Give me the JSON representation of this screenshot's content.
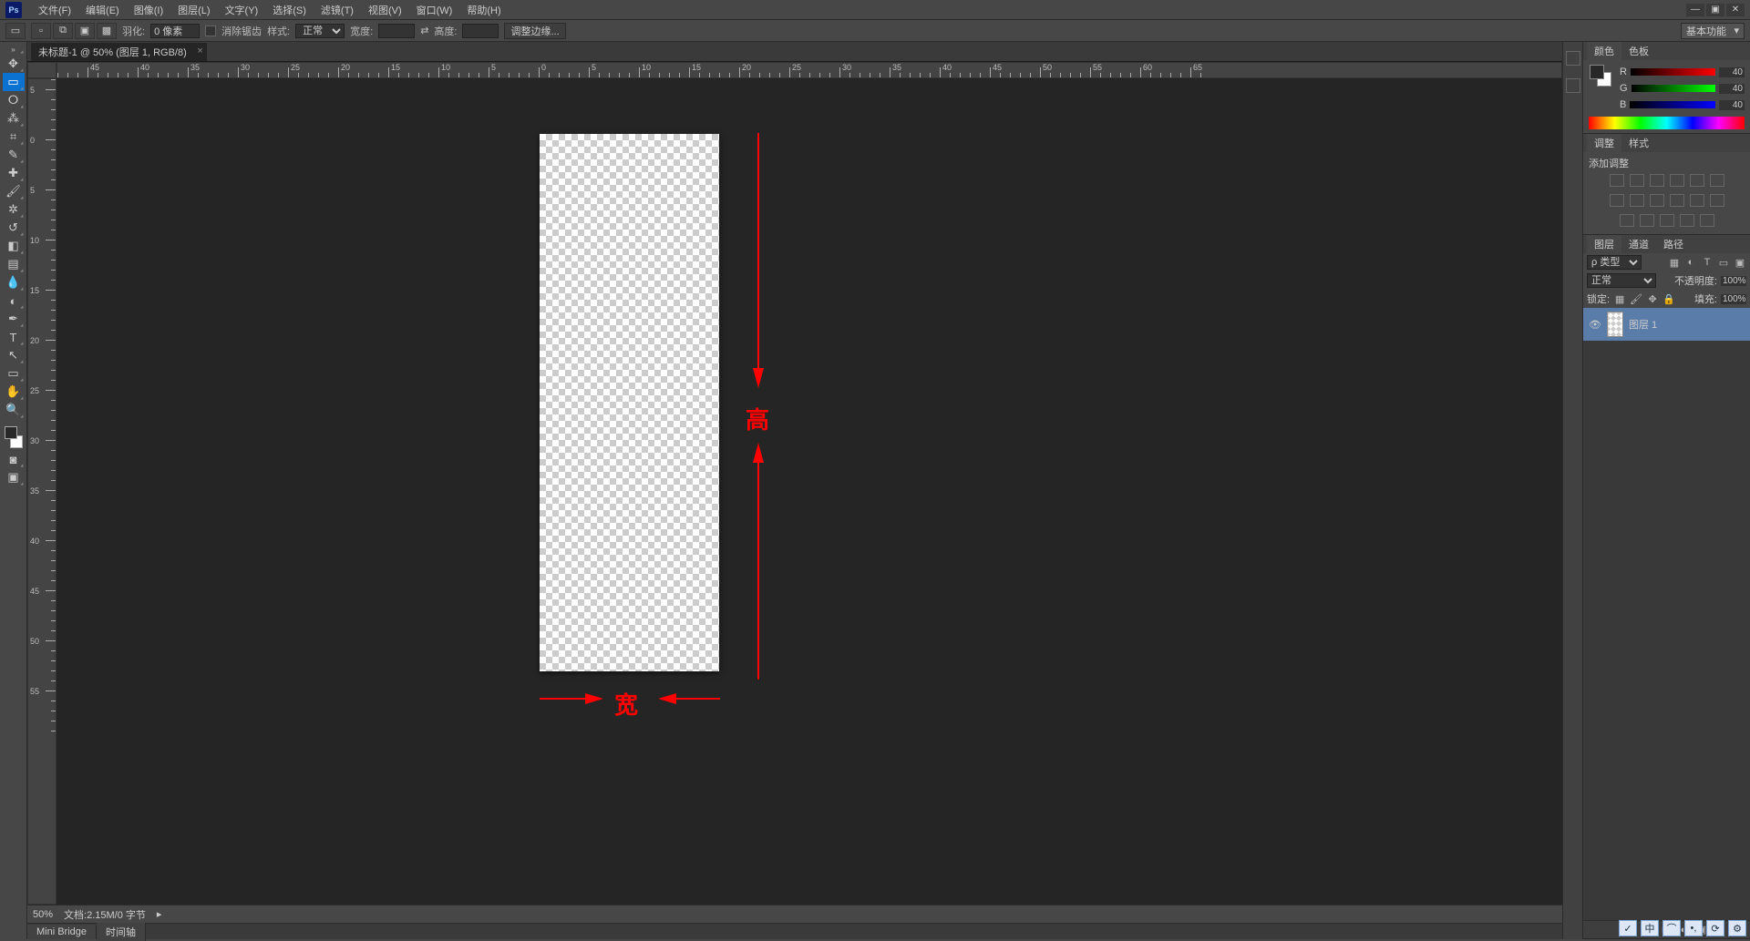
{
  "menu": [
    "文件(F)",
    "编辑(E)",
    "图像(I)",
    "图层(L)",
    "文字(Y)",
    "选择(S)",
    "滤镜(T)",
    "视图(V)",
    "窗口(W)",
    "帮助(H)"
  ],
  "optionsBar": {
    "featherLabel": "羽化:",
    "featherValue": "0 像素",
    "antiAliasLabel": "消除锯齿",
    "styleLabel": "样式:",
    "styleValue": "正常",
    "widthLabel": "宽度:",
    "heightLabel": "高度:",
    "refineEdge": "调整边缘...",
    "workspace": "基本功能"
  },
  "documentTab": "未标题-1 @ 50% (图层 1, RGB/8)",
  "status": {
    "zoom": "50%",
    "docInfo": "文档:2.15M/0 字节"
  },
  "bottomTabs": [
    "Mini Bridge",
    "时间轴"
  ],
  "annotations": {
    "height": "高",
    "width": "宽"
  },
  "panels": {
    "color": {
      "tab1": "颜色",
      "tab2": "色板",
      "R": "R",
      "G": "G",
      "B": "B",
      "rVal": "40",
      "gVal": "40",
      "bVal": "40"
    },
    "adjust": {
      "tab1": "调整",
      "tab2": "样式",
      "addLabel": "添加调整"
    },
    "layers": {
      "tab1": "图层",
      "tab2": "通道",
      "tab3": "路径",
      "kindLabel": "ρ 类型",
      "blendMode": "正常",
      "opacityLabel": "不透明度:",
      "opacityValue": "100%",
      "lockLabel": "锁定:",
      "fillLabel": "填充:",
      "fillValue": "100%",
      "layerName": "图层 1"
    }
  },
  "ime": [
    "✓",
    "中",
    "⌒",
    "•,",
    "⟳",
    "⚙"
  ]
}
